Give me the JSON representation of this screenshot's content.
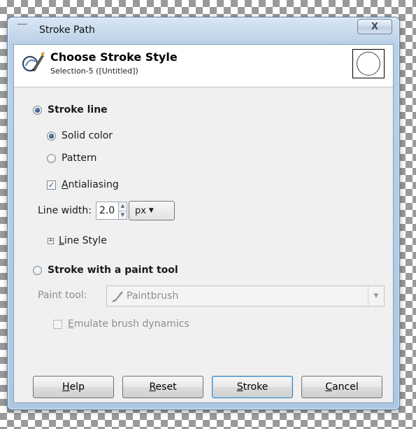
{
  "window": {
    "title": "Stroke Path",
    "close_label": "X"
  },
  "header": {
    "title": "Choose Stroke Style",
    "subtitle": "Selection-5 ([Untitled])"
  },
  "stroke_line": {
    "label": "Stroke line",
    "solid_color_label": "Solid color",
    "pattern_label": "Pattern",
    "antialiasing_label": "Antialiasing",
    "antialiasing_checked": true,
    "line_width_label": "Line width:",
    "line_width_value": "2.0",
    "unit_value": "px",
    "line_style_label": "Line Style"
  },
  "paint_tool": {
    "label": "Stroke with a paint tool",
    "tool_label": "Paint tool:",
    "tool_value": "Paintbrush",
    "emulate_label": "Emulate brush dynamics"
  },
  "buttons": {
    "help": "Help",
    "reset": "Reset",
    "stroke": "Stroke",
    "cancel": "Cancel"
  }
}
